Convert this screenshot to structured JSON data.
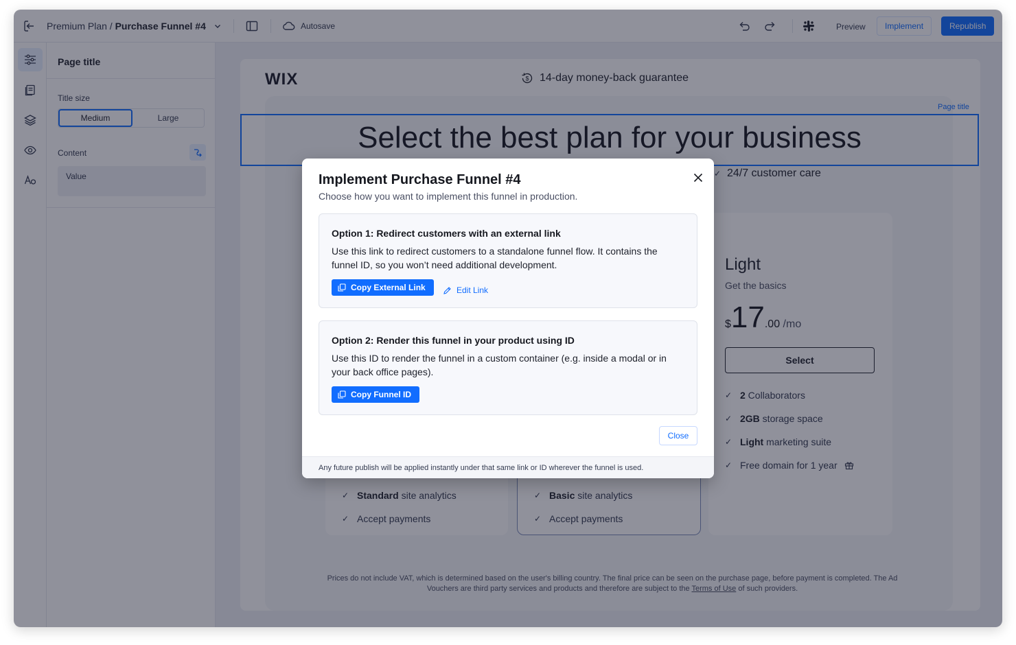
{
  "topbar": {
    "breadcrumb_plan": "Premium Plan",
    "breadcrumb_sep": " / ",
    "breadcrumb_funnel": "Purchase Funnel #4",
    "autosave": "Autosave",
    "preview": "Preview",
    "implement": "Implement",
    "republish": "Republish"
  },
  "rail": {
    "items": [
      "settings-sliders-icon",
      "pages-icon",
      "layers-icon",
      "visibility-icon",
      "typography-icon"
    ]
  },
  "panel": {
    "title": "Page title",
    "title_size_label": "Title size",
    "size_options": [
      "Medium",
      "Large"
    ],
    "size_selected": "Medium",
    "content_label": "Content",
    "content_value": "Value"
  },
  "page": {
    "logo": "WIX",
    "guarantee": "14-day money-back guarantee",
    "title_tag": "Page title",
    "hero_title": "Select the best plan for your business",
    "customer_care": "24/7 customer care",
    "light_card": {
      "title": "Light",
      "subtitle": "Get the basics",
      "currency": "$",
      "price_whole": "17",
      "price_cents": ".00",
      "period": " /mo",
      "select": "Select",
      "features": [
        {
          "bold": "2",
          "rest": " Collaborators"
        },
        {
          "bold": "2GB",
          "rest": " storage space"
        },
        {
          "bold": "Light",
          "rest": " marketing suite"
        },
        {
          "bold": "",
          "rest": "Free domain for 1 year"
        }
      ]
    },
    "card_left": {
      "features": [
        {
          "bold": "Standard",
          "rest": " site analytics"
        },
        {
          "bold": "",
          "rest": "Accept payments"
        }
      ]
    },
    "card_mid": {
      "features": [
        {
          "bold": "Basic",
          "rest": " site analytics"
        },
        {
          "bold": "",
          "rest": "Accept payments"
        }
      ]
    },
    "disclaimer_a": "Prices do not include VAT, which is determined based on the user's billing country. The final price can be seen on the purchase page, before payment is completed. The Ad Vouchers are third party services and products and therefore are subject to the ",
    "disclaimer_link": "Terms of Use",
    "disclaimer_b": " of such providers."
  },
  "modal": {
    "title": "Implement Purchase Funnel #4",
    "subtitle": "Choose how you want to implement this funnel in production.",
    "option1": {
      "title": "Option 1: Redirect customers with an external link",
      "desc": "Use this link to redirect customers to a standalone funnel flow. It contains the funnel ID, so you won’t need additional development.",
      "primary": "Copy External Link",
      "secondary": "Edit Link"
    },
    "option2": {
      "title": "Option 2: Render this funnel in your product using ID",
      "desc": "Use this ID to render the funnel in a custom container (e.g. inside a modal or in your back office pages).",
      "primary": "Copy Funnel ID"
    },
    "close": "Close",
    "footer": "Any future publish will be applied instantly under that same link or ID wherever the funnel is used."
  },
  "colors": {
    "accent": "#116dff",
    "overlay": "#161a2e",
    "text": "#20232d"
  }
}
